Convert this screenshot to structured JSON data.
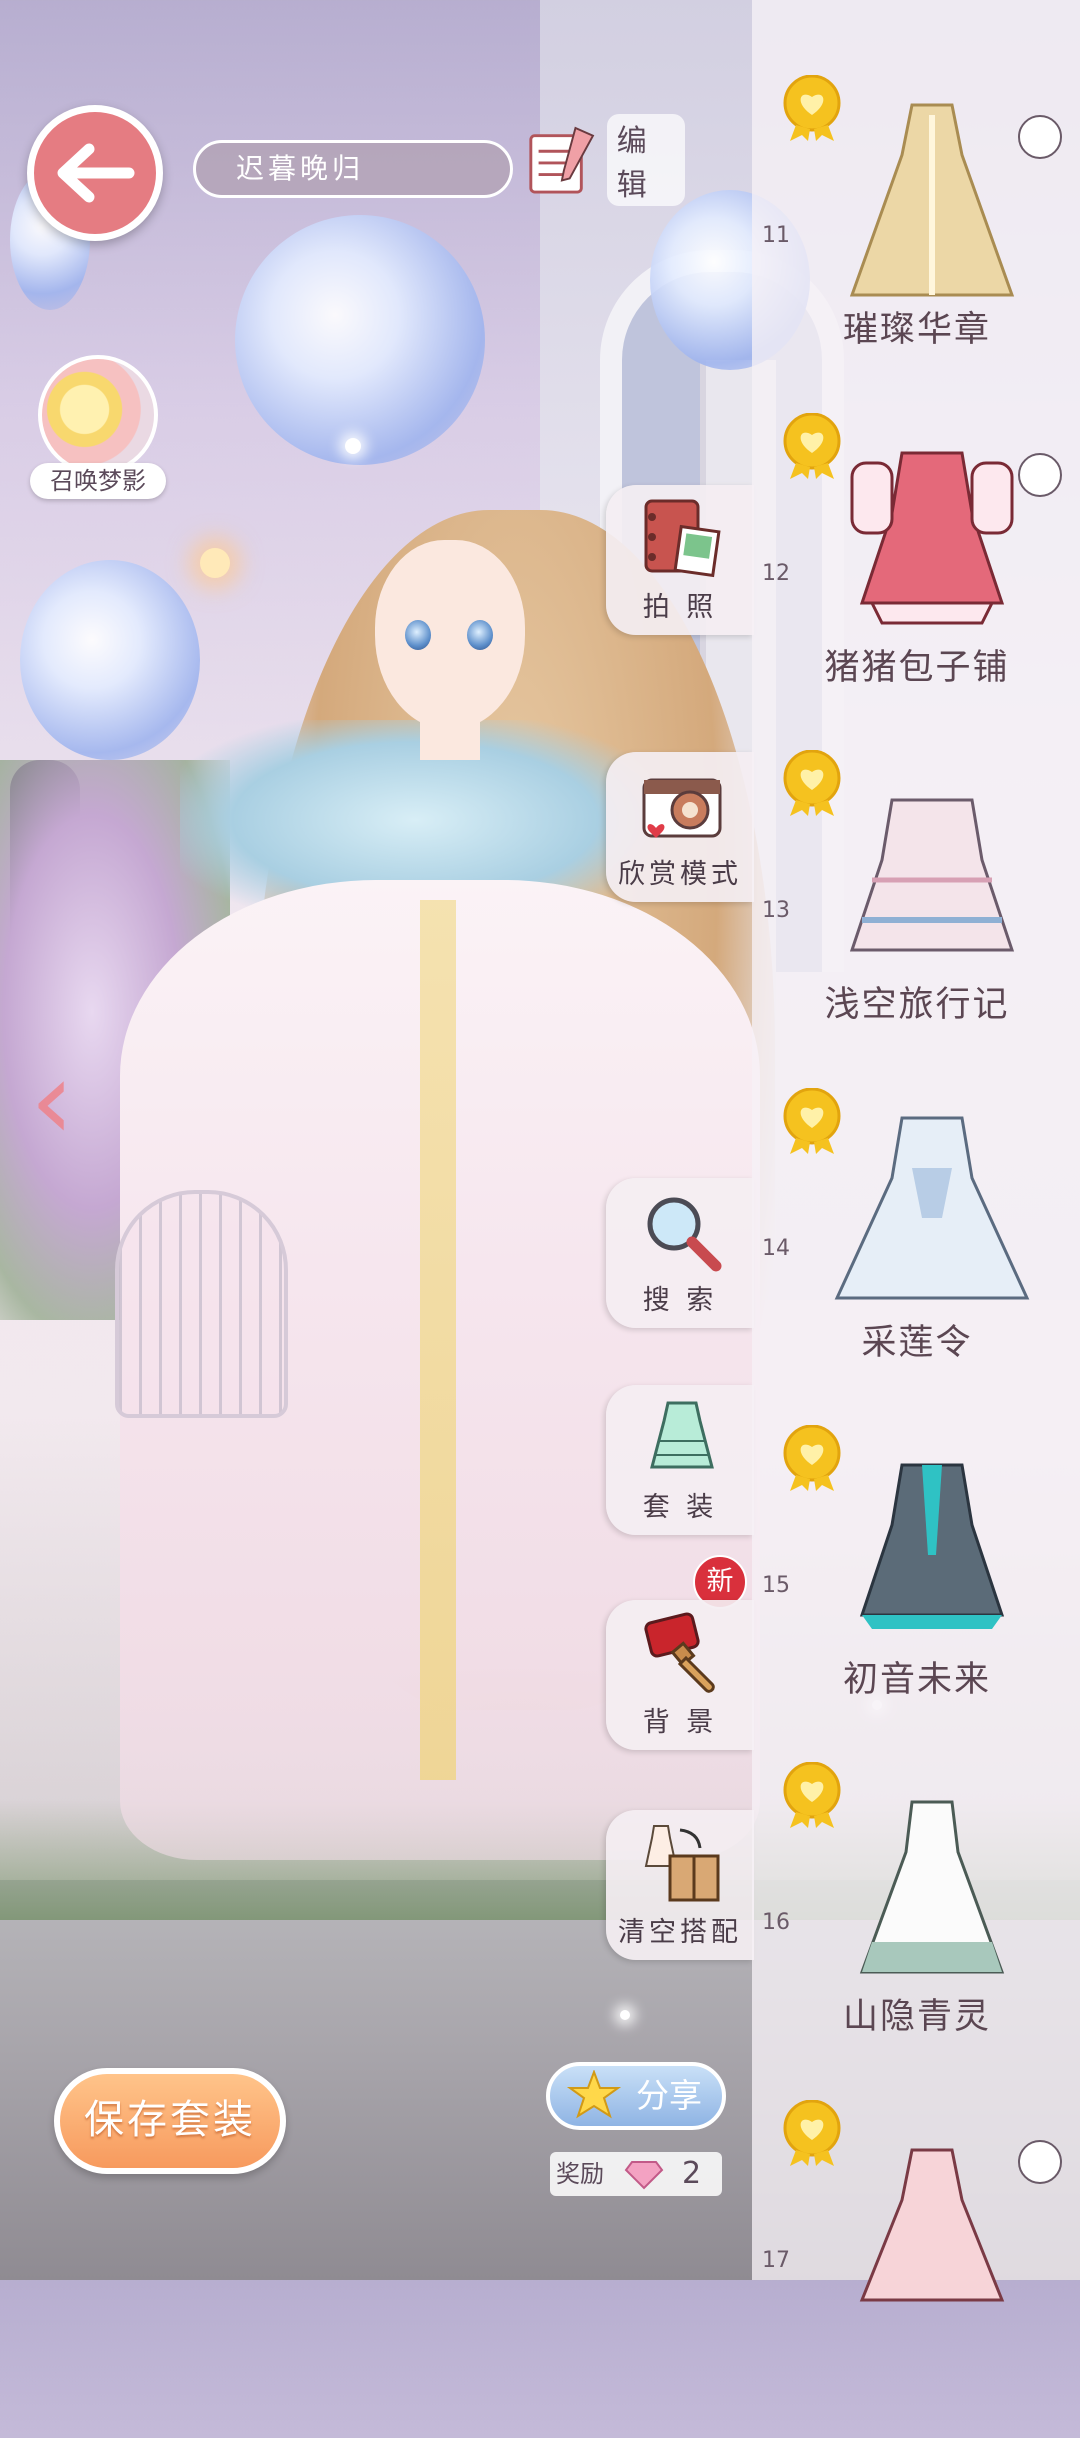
{
  "header": {
    "outfit_name": "迟暮晚归",
    "edit_label": "编辑"
  },
  "summon": {
    "label": "召唤梦影"
  },
  "side_menu": [
    {
      "label": "拍 照",
      "icon": "photo-album-icon"
    },
    {
      "label": "欣赏模式",
      "icon": "camera-icon"
    },
    {
      "label": "搜 索",
      "icon": "magnifier-icon"
    },
    {
      "label": "套 装",
      "icon": "dress-suit-icon"
    },
    {
      "label": "背 景",
      "icon": "paint-brush-icon"
    },
    {
      "label": "清空搭配",
      "icon": "clear-outfit-box-icon"
    }
  ],
  "new_badge": "新",
  "suits": [
    {
      "index": "11",
      "title": "璀璨华章",
      "has_action": true
    },
    {
      "index": "12",
      "title": "猪猪包子铺",
      "has_action": true
    },
    {
      "index": "13",
      "title": "浅空旅行记",
      "has_action": false
    },
    {
      "index": "14",
      "title": "采莲令",
      "has_action": false
    },
    {
      "index": "15",
      "title": "初音未来",
      "has_action": false
    },
    {
      "index": "16",
      "title": "山隐青灵",
      "has_action": false
    },
    {
      "index": "17",
      "title": "",
      "has_action": true
    }
  ],
  "bottom": {
    "save_label": "保存套装",
    "share_label": "分享",
    "reward_label": "奖励",
    "reward_value": "2"
  },
  "colors": {
    "accent_pink": "#e57c82",
    "save_orange": "#f79a5e",
    "share_blue": "#8fb4e4",
    "badge_red": "#d9303c",
    "medal_gold": "#f5c21f"
  }
}
